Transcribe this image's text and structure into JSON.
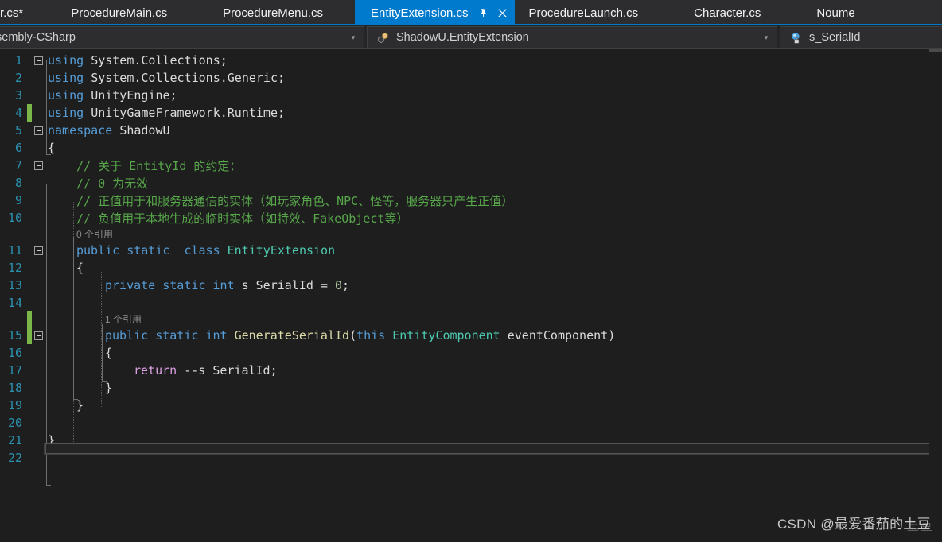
{
  "tabs": [
    {
      "label": "r.cs*",
      "active": false,
      "partial": true
    },
    {
      "label": "ProcedureMain.cs",
      "active": false,
      "partial": false
    },
    {
      "label": "ProcedureMenu.cs",
      "active": false,
      "partial": false
    },
    {
      "label": "EntityExtension.cs",
      "active": true,
      "partial": false
    },
    {
      "label": "ProcedureLaunch.cs",
      "active": false,
      "partial": false
    },
    {
      "label": "Character.cs",
      "active": false,
      "partial": false
    },
    {
      "label": "Noume",
      "active": false,
      "partial": false
    }
  ],
  "tab_icons": {
    "pin": "pin-icon",
    "close": "close-icon"
  },
  "navbar": {
    "project": "sembly-CSharp",
    "project_icon": "csharp-project-icon",
    "type": "ShadowU.EntityExtension",
    "type_icon": "class-icon",
    "member": "s_SerialId",
    "member_icon": "private-field-icon",
    "caret_glyph": "▾"
  },
  "editor": {
    "lines": [
      {
        "n": "1",
        "indent": 0
      },
      {
        "n": "2",
        "indent": 0
      },
      {
        "n": "3",
        "indent": 0
      },
      {
        "n": "4",
        "indent": 0
      },
      {
        "n": "5",
        "indent": 0
      },
      {
        "n": "6",
        "indent": 0
      },
      {
        "n": "7",
        "indent": 0
      },
      {
        "n": "8",
        "indent": 0
      },
      {
        "n": "9",
        "indent": 0
      },
      {
        "n": "10",
        "indent": 0
      },
      {
        "n": "11",
        "indent": 0
      },
      {
        "n": "12",
        "indent": 0
      },
      {
        "n": "13",
        "indent": 0
      },
      {
        "n": "14",
        "indent": 0
      },
      {
        "n": "15",
        "indent": 0
      },
      {
        "n": "16",
        "indent": 0
      },
      {
        "n": "17",
        "indent": 0
      },
      {
        "n": "18",
        "indent": 0
      },
      {
        "n": "19",
        "indent": 0
      },
      {
        "n": "20",
        "indent": 0
      },
      {
        "n": "21",
        "indent": 0
      },
      {
        "n": "22",
        "indent": 0
      }
    ],
    "code": {
      "l1": "using System.Collections;",
      "l2": "using System.Collections.Generic;",
      "l3": "using UnityEngine;",
      "l4": "using UnityGameFramework.Runtime;",
      "l5": "namespace ShadowU",
      "l6": "{",
      "l7": "// 关于 EntityId 的约定：",
      "l8": "// 0 为无效",
      "l9": "// 正值用于和服务器通信的实体（如玩家角色、NPC、怪等，服务器只产生正值）",
      "l10": "// 负值用于本地生成的临时实体（如特效、FakeObject等）",
      "l11": "public static  class EntityExtension",
      "l12": "{",
      "l13": "private static int s_SerialId = 0;",
      "l14": "",
      "l15": "public static int GenerateSerialId(this EntityComponent eventComponent)",
      "l16": "{",
      "l17": "return --s_SerialId;",
      "l18": "}",
      "l19": "}",
      "l20": "",
      "l21": "}",
      "l22": ""
    },
    "tokens": {
      "using": "using",
      "sys_collections": "System.Collections;",
      "sys_collections_generic": "System.Collections.Generic;",
      "unityengine": "UnityEngine;",
      "ugf_runtime": "UnityGameFramework.Runtime;",
      "namespace": "namespace",
      "shadowu": "ShadowU",
      "brace_open": "{",
      "brace_close": "}",
      "cmt7": "// 关于 EntityId 的约定：",
      "cmt8": "// 0 为无效",
      "cmt9": "// 正值用于和服务器通信的实体（如玩家角色、NPC、怪等，服务器只产生正值）",
      "cmt10": "// 负值用于本地生成的临时实体（如特效、FakeObject等）",
      "public": "public",
      "static": "static",
      "class": "class",
      "EntityExtension": "EntityExtension",
      "private": "private",
      "int": "int",
      "s_SerialId": "s_SerialId",
      "eq": "=",
      "zero": "0",
      "semi": ";",
      "GenerateSerialId": "GenerateSerialId",
      "this": "this",
      "EntityComponent": "EntityComponent",
      "eventComponent": "eventComponent",
      "paren_open": "(",
      "paren_close": ")",
      "return": "return",
      "dec_s_SerialId": "--s_SerialId;"
    },
    "codelens": {
      "class_refs": "0 个引用",
      "method_refs": "1 个引用"
    }
  },
  "watermark": {
    "text": "CSDN @最爱番茄的土豆",
    "ghost": "土豆"
  },
  "colors": {
    "accent": "#007acc",
    "editor_bg": "#1e1e1e",
    "tabbar_bg": "#2d2d30",
    "keyword": "#569cd6",
    "type": "#4ec9b0",
    "comment": "#57a64a",
    "number": "#b5cea8",
    "method": "#dcdcaa",
    "control": "#d8a0df",
    "param": "#9cdcfe",
    "linenumber": "#2b91af",
    "change_marker": "#7ab648"
  }
}
